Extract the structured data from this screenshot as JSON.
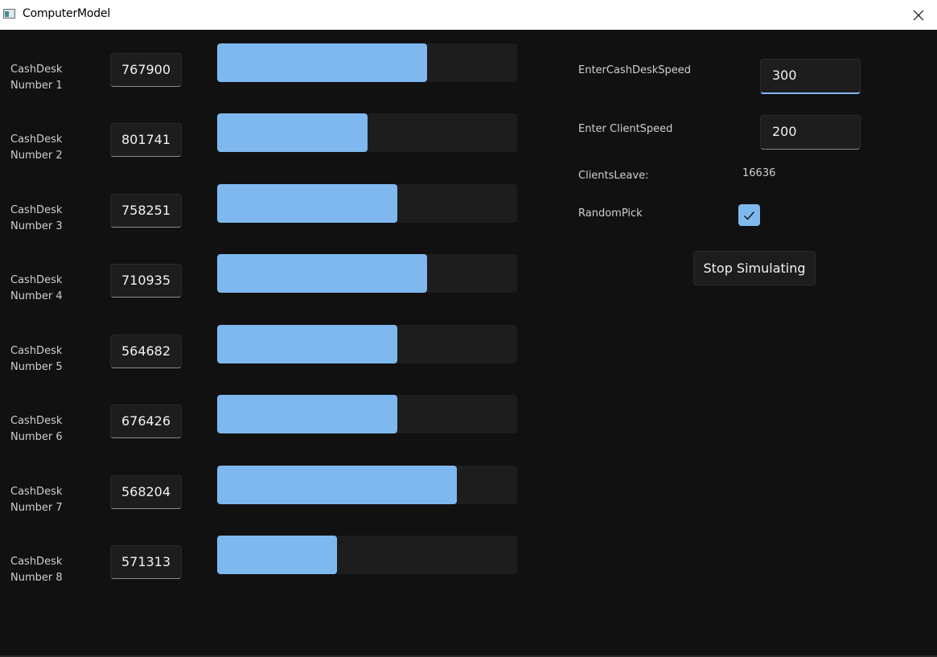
{
  "window": {
    "title": "ComputerModel",
    "icon": "app-window-icon",
    "close_icon": "close-icon"
  },
  "cash_desks": [
    {
      "label_line1": "CashDesk",
      "label_line2": "Number 1",
      "value": "767900",
      "progress": 0.7
    },
    {
      "label_line1": "CashDesk",
      "label_line2": "Number 2",
      "value": "801741",
      "progress": 0.5
    },
    {
      "label_line1": "CashDesk",
      "label_line2": "Number 3",
      "value": "758251",
      "progress": 0.6
    },
    {
      "label_line1": "CashDesk",
      "label_line2": "Number 4",
      "value": "710935",
      "progress": 0.7
    },
    {
      "label_line1": "CashDesk",
      "label_line2": "Number 5",
      "value": "564682",
      "progress": 0.6
    },
    {
      "label_line1": "CashDesk",
      "label_line2": "Number 6",
      "value": "676426",
      "progress": 0.6
    },
    {
      "label_line1": "CashDesk",
      "label_line2": "Number 7",
      "value": "568204",
      "progress": 0.8
    },
    {
      "label_line1": "CashDesk",
      "label_line2": "Number 8",
      "value": "571313",
      "progress": 0.4
    }
  ],
  "controls": {
    "cashdesk_speed_label": "EnterCashDeskSpeed",
    "cashdesk_speed_value": "300",
    "client_speed_label": "Enter ClientSpeed",
    "client_speed_value": "200",
    "clients_leave_label": "ClientsLeave:",
    "clients_leave_value": "16636",
    "random_pick_label": "RandomPick",
    "random_pick_checked": true,
    "stop_button_label": "Stop Simulating"
  },
  "colors": {
    "background": "#111111",
    "accent": "#7fb8ee",
    "control_bg": "#1d1d1d",
    "text": "#cfcfcf"
  }
}
